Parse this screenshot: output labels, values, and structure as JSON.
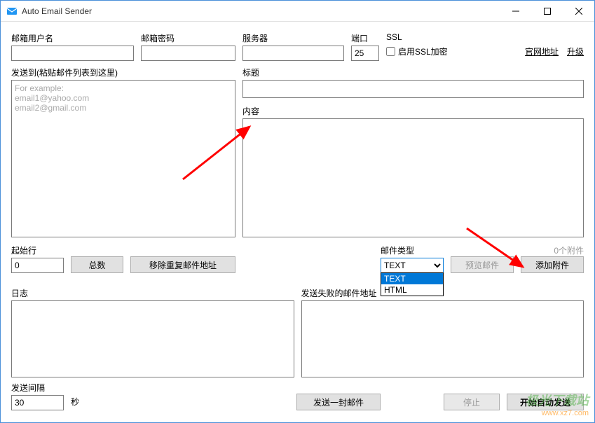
{
  "titlebar": {
    "title": "Auto Email Sender"
  },
  "credentials": {
    "username_label": "邮箱用户名",
    "username_value": "",
    "password_label": "邮箱密码",
    "password_value": "",
    "server_label": "服务器",
    "server_value": "",
    "port_label": "端口",
    "port_value": "25",
    "ssl_label": "SSL",
    "ssl_checkbox_label": "启用SSL加密"
  },
  "links": {
    "official": "官网地址",
    "upgrade": "升级"
  },
  "recipients": {
    "label": "发送到(粘贴邮件列表到这里)",
    "placeholder": "For example:\nemail1@yahoo.com\nemail2@gmail.com",
    "value": ""
  },
  "subject": {
    "label": "标题",
    "value": ""
  },
  "body": {
    "label": "内容",
    "value": ""
  },
  "start_row": {
    "label": "起始行",
    "value": "0"
  },
  "total_button": "总数",
  "remove_dup_button": "移除重复邮件地址",
  "mail_type": {
    "label": "邮件类型",
    "selected": "TEXT",
    "options": [
      "TEXT",
      "HTML"
    ]
  },
  "preview_button": "预览邮件",
  "attachment_count": "0个附件",
  "add_attachment_button": "添加附件",
  "log": {
    "label": "日志",
    "value": ""
  },
  "failed": {
    "label": "发送失败的邮件地址",
    "value": ""
  },
  "interval": {
    "label": "发送间隔",
    "value": "30",
    "unit": "秒"
  },
  "send_one_button": "发送一封邮件",
  "stop_button": "停止",
  "start_auto_button": "开始自动发送",
  "watermark": {
    "line1": "极光下载站",
    "line2": "www.xz7.com"
  }
}
